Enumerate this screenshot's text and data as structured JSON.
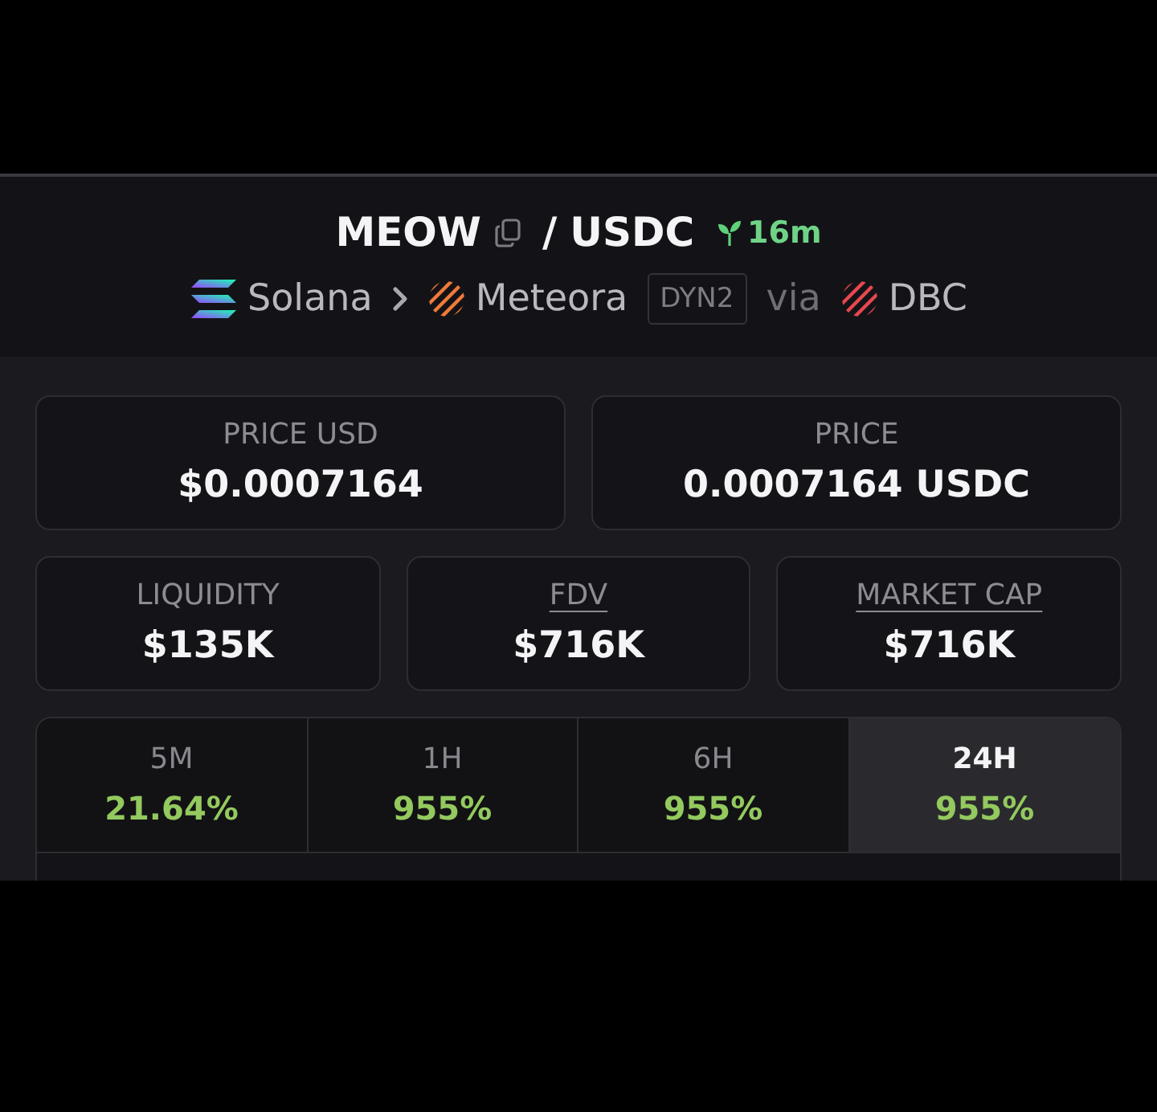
{
  "pair": {
    "base": "MEOW",
    "separator": "/",
    "quote": "USDC",
    "age": "16m"
  },
  "route": {
    "chain": "Solana",
    "dex": "Meteora",
    "pool_type": "DYN2",
    "via": "via",
    "launchpad": "DBC"
  },
  "stats_rows": [
    {
      "cards": [
        {
          "label": "PRICE USD",
          "value": "$0.0007164",
          "link": false
        },
        {
          "label": "PRICE",
          "value": "0.0007164 USDC",
          "link": false
        }
      ]
    },
    {
      "cards": [
        {
          "label": "LIQUIDITY",
          "value": "$135K",
          "link": false
        },
        {
          "label": "FDV",
          "value": "$716K",
          "link": true
        },
        {
          "label": "MARKET CAP",
          "value": "$716K",
          "link": true
        }
      ]
    }
  ],
  "timeframes": [
    {
      "label": "5M",
      "change": "21.64%",
      "selected": false
    },
    {
      "label": "1H",
      "change": "955%",
      "selected": false
    },
    {
      "label": "6H",
      "change": "955%",
      "selected": false
    },
    {
      "label": "24H",
      "change": "955%",
      "selected": true
    }
  ]
}
